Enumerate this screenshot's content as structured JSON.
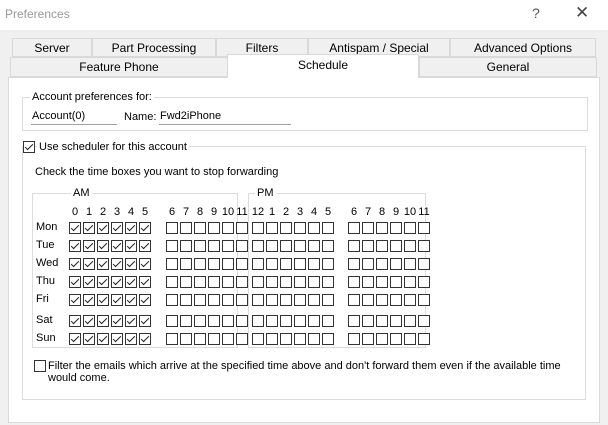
{
  "window": {
    "title": "Preferences",
    "help_label": "?",
    "close_label": "✕"
  },
  "tabs_row1": [
    "Server",
    "Part Processing",
    "Filters",
    "Antispam / Special",
    "Advanced Options"
  ],
  "tabs_row2": [
    "Feature Phone",
    "Schedule",
    "General"
  ],
  "active_tab": "Schedule",
  "account": {
    "group_label": "Account preferences for:",
    "account_value": "Account(0)",
    "name_label": "Name:",
    "name_value": "Fwd2iPhone"
  },
  "scheduler": {
    "label": "Use scheduler for this account",
    "checked": true
  },
  "instruction": "Check the time boxes you want to stop forwarding",
  "am": {
    "label": "AM",
    "hours": [
      "0",
      "1",
      "2",
      "3",
      "4",
      "5",
      "6",
      "7",
      "8",
      "9",
      "10",
      "11"
    ]
  },
  "pm": {
    "label": "PM",
    "hours": [
      "12",
      "1",
      "2",
      "3",
      "4",
      "5",
      "6",
      "7",
      "8",
      "9",
      "10",
      "11"
    ]
  },
  "days": [
    {
      "name": "Mon",
      "am": [
        1,
        1,
        1,
        1,
        1,
        1,
        0,
        0,
        0,
        0,
        0,
        0
      ],
      "pm": [
        0,
        0,
        0,
        0,
        0,
        0,
        0,
        0,
        0,
        0,
        0,
        0
      ]
    },
    {
      "name": "Tue",
      "am": [
        1,
        1,
        1,
        1,
        1,
        1,
        0,
        0,
        0,
        0,
        0,
        0
      ],
      "pm": [
        0,
        0,
        0,
        0,
        0,
        0,
        0,
        0,
        0,
        0,
        0,
        0
      ]
    },
    {
      "name": "Wed",
      "am": [
        1,
        1,
        1,
        1,
        1,
        1,
        0,
        0,
        0,
        0,
        0,
        0
      ],
      "pm": [
        0,
        0,
        0,
        0,
        0,
        0,
        0,
        0,
        0,
        0,
        0,
        0
      ]
    },
    {
      "name": "Thu",
      "am": [
        1,
        1,
        1,
        1,
        1,
        1,
        0,
        0,
        0,
        0,
        0,
        0
      ],
      "pm": [
        0,
        0,
        0,
        0,
        0,
        0,
        0,
        0,
        0,
        0,
        0,
        0
      ]
    },
    {
      "name": "Fri",
      "am": [
        1,
        1,
        1,
        1,
        1,
        1,
        0,
        0,
        0,
        0,
        0,
        0
      ],
      "pm": [
        0,
        0,
        0,
        0,
        0,
        0,
        0,
        0,
        0,
        0,
        0,
        0
      ]
    },
    {
      "name": "Sat",
      "am": [
        1,
        1,
        1,
        1,
        1,
        1,
        0,
        0,
        0,
        0,
        0,
        0
      ],
      "pm": [
        0,
        0,
        0,
        0,
        0,
        0,
        0,
        0,
        0,
        0,
        0,
        0
      ]
    },
    {
      "name": "Sun",
      "am": [
        1,
        1,
        1,
        1,
        1,
        1,
        0,
        0,
        0,
        0,
        0,
        0
      ],
      "pm": [
        0,
        0,
        0,
        0,
        0,
        0,
        0,
        0,
        0,
        0,
        0,
        0
      ]
    }
  ],
  "filter": {
    "label": "Filter the emails which arrive at the specified time above and don't forward them even if the available time would come.",
    "checked": false
  }
}
